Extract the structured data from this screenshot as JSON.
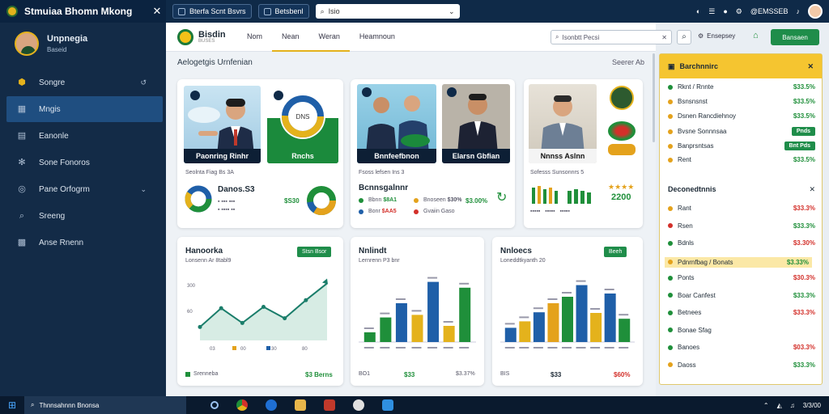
{
  "titlebar": {
    "app_title": "Stmuiaa Bhomn Mkong",
    "chip1": "Bterfa Scnt Bsvrs",
    "chip2": "Betsbenl",
    "search_placeholder": "Isio",
    "right_text": "@EMSSEB"
  },
  "sidebar": {
    "user_name": "Unpnegia",
    "user_sub": "Baseid",
    "items": [
      {
        "label": "Songre",
        "icon": "shield-icon"
      },
      {
        "label": "Mngis",
        "icon": "chart-icon"
      },
      {
        "label": "Eanonle",
        "icon": "document-icon"
      },
      {
        "label": "Sone Fonoros",
        "icon": "gear-icon"
      },
      {
        "label": "Pane Orfogrm",
        "icon": "target-icon"
      },
      {
        "label": "Sreeng",
        "icon": "search-icon"
      },
      {
        "label": "Anse Rnenn",
        "icon": "grid-icon"
      }
    ]
  },
  "topbar": {
    "brand": "Bisdin",
    "brand_sub": "BUSES",
    "tabs": [
      "Nom",
      "Nean",
      "Weran",
      "Heamnoun"
    ],
    "search_placeholder": "Isonbtt Pecsi",
    "right_label": "Ensepsey",
    "action_label": "Bansaen"
  },
  "section": {
    "title": "Aelogetgis Urnfenian",
    "right": "Seerer Ab"
  },
  "cards_top": [
    {
      "caption1": "Paonring Rinhr",
      "caption2": "Rnchs",
      "sub": "Seolnta Fiag Bs 3A",
      "value_title": "Danos.S3",
      "value_amount": "$S30",
      "donut_center": "DNS"
    },
    {
      "caption1": "Bnnfeefbnon",
      "caption2": "Elarsn Gbfian",
      "sub": "Fsoss lefsen Ins 3",
      "value_title": "Bcnnsgalnnr",
      "items": [
        {
          "label": "Bbnn",
          "value": "$8A1",
          "color": "#1f8f3a"
        },
        {
          "label": "Bnoseen",
          "value": "$30%",
          "color": "#e4a21c"
        },
        {
          "label": "Bonr",
          "value": "$AA5",
          "color": "#1f5fa8"
        },
        {
          "label": "Gvaiin Gaso",
          "value": "",
          "color": "#d3302a"
        }
      ],
      "side_value": "$3.00%"
    },
    {
      "caption1": "Nnnss Aslnn",
      "sub": "Sofesss Sunsonnrs 5",
      "value_amount": "2200"
    }
  ],
  "charts": [
    {
      "title": "Hanoorka",
      "sub": "Lonsenn Ar 8tabl9",
      "button": "Stsn Bsor",
      "footer_left": "Srenneba",
      "footer_right": "$3 Berns",
      "ylabels": [
        "300",
        "60"
      ],
      "xlabels": [
        "03",
        "00",
        "30",
        "80"
      ]
    },
    {
      "title": "Nnlindt",
      "sub": "Lernrenn P3 bnr",
      "footer_left": "BO1",
      "footer_mid": "$33",
      "footer_right": "$3.37%"
    },
    {
      "title": "Nnloecs",
      "sub": "Loneddtkyanth 20",
      "button": "Beeh",
      "footer_left": "BIS",
      "footer_mid": "$33",
      "footer_right": "$60%"
    }
  ],
  "chart_data": [
    {
      "type": "area",
      "x": [
        1,
        2,
        3,
        4,
        5,
        6,
        7
      ],
      "series": [
        {
          "values": [
            20,
            48,
            26,
            50,
            33,
            60,
            85
          ]
        }
      ],
      "ylim": [
        0,
        100
      ]
    },
    {
      "type": "bar",
      "categories": [
        "a",
        "b",
        "c",
        "d",
        "e",
        "f",
        "g"
      ],
      "values": [
        15,
        38,
        60,
        42,
        93,
        25,
        84
      ],
      "ylim": [
        0,
        100
      ]
    },
    {
      "type": "bar",
      "categories": [
        "a",
        "b",
        "c",
        "d",
        "e",
        "f",
        "g",
        "h",
        "i"
      ],
      "values": [
        22,
        32,
        46,
        60,
        70,
        88,
        45,
        75,
        36
      ],
      "ylim": [
        0,
        100
      ]
    }
  ],
  "rpanel": {
    "title": "Barchnnirc",
    "rows": [
      {
        "label": "Rknt",
        "sub": "Rnnte",
        "value": "$33.5%",
        "color": "#1f8f3a"
      },
      {
        "label": "Bsnsnsnst",
        "value": "$33.5%",
        "color": "#e4a21c"
      },
      {
        "label": "Dsnen Rancdiehnoy",
        "value": "$33.5%",
        "color": "#e4a21c"
      },
      {
        "label": "Bvsne Sonnnsaa",
        "value": "Pnds",
        "color": "#e4a21c"
      },
      {
        "label": "Banprsntsas",
        "value": "Bnt Pds",
        "color": "#e4a21c"
      },
      {
        "label": "Rent",
        "value": "$33.5%",
        "color": "#e4a21c"
      }
    ],
    "section2": "Deconedtnnis",
    "rows2": [
      {
        "label": "Rant",
        "value": "$33.3%",
        "color": "#e4a21c"
      },
      {
        "label": "Rsen",
        "value": "$33.3%",
        "color": "#d3302a"
      },
      {
        "label": "Bdnls",
        "value": "$3.30%",
        "color": "#1f8f3a"
      },
      {
        "label": "Pdnrnfbag",
        "sub": "Bonats",
        "value": "$3.33%",
        "color": "#e4a21c"
      },
      {
        "label": "Ponts",
        "value": "$30.3%",
        "color": "#1f8f3a"
      },
      {
        "label": "Boar Canfest",
        "value": "$33.3%",
        "color": "#1f8f3a"
      },
      {
        "label": "Betnees",
        "value": "$33.3%",
        "color": "#1f8f3a"
      },
      {
        "label": "Bonae Sfag",
        "value": "",
        "color": "#1f8f3a"
      },
      {
        "label": "Banoes",
        "value": "$03.3%",
        "color": "#1f8f3a"
      },
      {
        "label": "Daoss",
        "value": "$33.3%",
        "color": "#e4a21c"
      }
    ]
  },
  "taskbar": {
    "search_text": "Thnnsahnnn Bnonsa",
    "tray_time": "3/3/00"
  }
}
